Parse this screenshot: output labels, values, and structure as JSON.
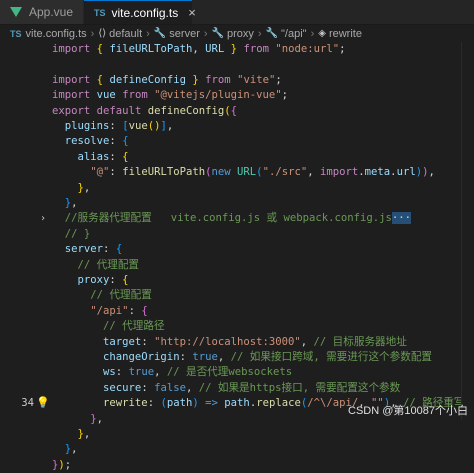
{
  "tabs": [
    {
      "label": "App.vue",
      "icon": "vue-icon",
      "active": false
    },
    {
      "label": "vite.config.ts",
      "icon": "ts-icon",
      "active": true
    }
  ],
  "breadcrumb": {
    "file_icon": "TS",
    "items": [
      "vite.config.ts",
      "default",
      "server",
      "proxy",
      "\"/api\"",
      "rewrite"
    ]
  },
  "editor": {
    "active_line": "34",
    "lines": [
      {
        "num": "",
        "tokens": [
          [
            "kw",
            "import"
          ],
          [
            "punc",
            " "
          ],
          [
            "br1",
            "{"
          ],
          [
            "punc",
            " "
          ],
          [
            "var",
            "fileURLToPath"
          ],
          [
            "punc",
            ", "
          ],
          [
            "var",
            "URL"
          ],
          [
            "punc",
            " "
          ],
          [
            "br1",
            "}"
          ],
          [
            "punc",
            " "
          ],
          [
            "kw",
            "from"
          ],
          [
            "punc",
            " "
          ],
          [
            "str",
            "\"node:url\""
          ],
          [
            "punc",
            ";"
          ]
        ]
      },
      {
        "num": "",
        "tokens": []
      },
      {
        "num": "",
        "tokens": [
          [
            "kw",
            "import"
          ],
          [
            "punc",
            " "
          ],
          [
            "br1",
            "{"
          ],
          [
            "punc",
            " "
          ],
          [
            "var",
            "defineConfig"
          ],
          [
            "punc",
            " "
          ],
          [
            "br1",
            "}"
          ],
          [
            "punc",
            " "
          ],
          [
            "kw",
            "from"
          ],
          [
            "punc",
            " "
          ],
          [
            "str",
            "\"vite\""
          ],
          [
            "punc",
            ";"
          ]
        ]
      },
      {
        "num": "",
        "tokens": [
          [
            "kw",
            "import"
          ],
          [
            "punc",
            " "
          ],
          [
            "var",
            "vue"
          ],
          [
            "punc",
            " "
          ],
          [
            "kw",
            "from"
          ],
          [
            "punc",
            " "
          ],
          [
            "str",
            "\"@vitejs/plugin-vue\""
          ],
          [
            "punc",
            ";"
          ]
        ]
      },
      {
        "num": "",
        "tokens": [
          [
            "kw",
            "export"
          ],
          [
            "punc",
            " "
          ],
          [
            "kw",
            "default"
          ],
          [
            "punc",
            " "
          ],
          [
            "fn",
            "defineConfig"
          ],
          [
            "br1",
            "("
          ],
          [
            "br2",
            "{"
          ]
        ]
      },
      {
        "num": "",
        "tokens": [
          [
            "punc",
            "  "
          ],
          [
            "prop",
            "plugins"
          ],
          [
            "punc",
            ": "
          ],
          [
            "br3",
            "["
          ],
          [
            "fn",
            "vue"
          ],
          [
            "br1",
            "()"
          ],
          [
            "br3",
            "]"
          ],
          [
            "punc",
            ","
          ]
        ]
      },
      {
        "num": "",
        "tokens": [
          [
            "punc",
            "  "
          ],
          [
            "prop",
            "resolve"
          ],
          [
            "punc",
            ": "
          ],
          [
            "br3",
            "{"
          ]
        ]
      },
      {
        "num": "",
        "tokens": [
          [
            "punc",
            "    "
          ],
          [
            "prop",
            "alias"
          ],
          [
            "punc",
            ": "
          ],
          [
            "br1",
            "{"
          ]
        ]
      },
      {
        "num": "",
        "tokens": [
          [
            "punc",
            "      "
          ],
          [
            "str",
            "\"@\""
          ],
          [
            "punc",
            ": "
          ],
          [
            "fn",
            "fileURLToPath"
          ],
          [
            "br2",
            "("
          ],
          [
            "kw2",
            "new"
          ],
          [
            "punc",
            " "
          ],
          [
            "cls",
            "URL"
          ],
          [
            "br3",
            "("
          ],
          [
            "str",
            "\"./src\""
          ],
          [
            "punc",
            ", "
          ],
          [
            "kw",
            "import"
          ],
          [
            "punc",
            "."
          ],
          [
            "prop",
            "meta"
          ],
          [
            "punc",
            "."
          ],
          [
            "prop",
            "url"
          ],
          [
            "br3",
            ")"
          ],
          [
            "br2",
            ")"
          ],
          [
            "punc",
            ","
          ]
        ]
      },
      {
        "num": "",
        "tokens": [
          [
            "punc",
            "    "
          ],
          [
            "br1",
            "}"
          ],
          [
            "punc",
            ","
          ]
        ]
      },
      {
        "num": "",
        "tokens": [
          [
            "punc",
            "  "
          ],
          [
            "br3",
            "}"
          ],
          [
            "punc",
            ","
          ]
        ]
      },
      {
        "num": "",
        "tokens": [
          [
            "punc",
            "  "
          ],
          [
            "cm",
            "//服务器代理配置   vite.config.js 或 webpack.config.js"
          ],
          [
            "punc",
            "···"
          ]
        ],
        "folded": true
      },
      {
        "num": "",
        "tokens": [
          [
            "punc",
            "  "
          ],
          [
            "cm",
            "// }"
          ]
        ]
      },
      {
        "num": "",
        "tokens": [
          [
            "punc",
            "  "
          ],
          [
            "prop",
            "server"
          ],
          [
            "punc",
            ": "
          ],
          [
            "br3",
            "{"
          ]
        ]
      },
      {
        "num": "",
        "tokens": [
          [
            "punc",
            "    "
          ],
          [
            "cm",
            "// 代理配置"
          ]
        ]
      },
      {
        "num": "",
        "tokens": [
          [
            "punc",
            "    "
          ],
          [
            "prop",
            "proxy"
          ],
          [
            "punc",
            ": "
          ],
          [
            "br1",
            "{"
          ]
        ]
      },
      {
        "num": "",
        "tokens": [
          [
            "punc",
            "      "
          ],
          [
            "cm",
            "// 代理配置"
          ]
        ]
      },
      {
        "num": "",
        "tokens": [
          [
            "punc",
            "      "
          ],
          [
            "str",
            "\"/api\""
          ],
          [
            "punc",
            ": "
          ],
          [
            "br2",
            "{"
          ]
        ]
      },
      {
        "num": "",
        "tokens": [
          [
            "punc",
            "        "
          ],
          [
            "cm",
            "// 代理路径"
          ]
        ]
      },
      {
        "num": "",
        "tokens": [
          [
            "punc",
            "        "
          ],
          [
            "prop",
            "target"
          ],
          [
            "punc",
            ": "
          ],
          [
            "str",
            "\"http://localhost:3000\""
          ],
          [
            "punc",
            ", "
          ],
          [
            "cm",
            "// 目标服务器地址"
          ]
        ]
      },
      {
        "num": "",
        "tokens": [
          [
            "punc",
            "        "
          ],
          [
            "prop",
            "changeOrigin"
          ],
          [
            "punc",
            ": "
          ],
          [
            "kw2",
            "true"
          ],
          [
            "punc",
            ", "
          ],
          [
            "cm",
            "// 如果接口跨域, 需要进行这个参数配置"
          ]
        ]
      },
      {
        "num": "",
        "tokens": [
          [
            "punc",
            "        "
          ],
          [
            "prop",
            "ws"
          ],
          [
            "punc",
            ": "
          ],
          [
            "kw2",
            "true"
          ],
          [
            "punc",
            ", "
          ],
          [
            "cm",
            "// 是否代理websockets"
          ]
        ]
      },
      {
        "num": "",
        "tokens": [
          [
            "punc",
            "        "
          ],
          [
            "prop",
            "secure"
          ],
          [
            "punc",
            ": "
          ],
          [
            "kw2",
            "false"
          ],
          [
            "punc",
            ", "
          ],
          [
            "cm",
            "// 如果是https接口, 需要配置这个参数"
          ]
        ]
      },
      {
        "num": "34",
        "tokens": [
          [
            "punc",
            "        "
          ],
          [
            "fn",
            "rewrite"
          ],
          [
            "punc",
            ": "
          ],
          [
            "br3",
            "("
          ],
          [
            "var",
            "path"
          ],
          [
            "br3",
            ")"
          ],
          [
            "punc",
            " "
          ],
          [
            "kw2",
            "=>"
          ],
          [
            "punc",
            " "
          ],
          [
            "var",
            "path"
          ],
          [
            "punc",
            "."
          ],
          [
            "fn",
            "replace"
          ],
          [
            "br3",
            "("
          ],
          [
            "str",
            "/^\\/api/"
          ],
          [
            "punc",
            ", "
          ],
          [
            "str",
            "\"\""
          ],
          [
            "br3",
            ")"
          ],
          [
            "punc",
            ", "
          ],
          [
            "cm",
            "// 路径重写"
          ]
        ]
      },
      {
        "num": "",
        "tokens": [
          [
            "punc",
            "      "
          ],
          [
            "br2",
            "}"
          ],
          [
            "punc",
            ","
          ]
        ]
      },
      {
        "num": "",
        "tokens": [
          [
            "punc",
            "    "
          ],
          [
            "br1",
            "}"
          ],
          [
            "punc",
            ","
          ]
        ]
      },
      {
        "num": "",
        "tokens": [
          [
            "punc",
            "  "
          ],
          [
            "br3",
            "}"
          ],
          [
            "punc",
            ","
          ]
        ]
      },
      {
        "num": "",
        "tokens": [
          [
            "br2",
            "}"
          ],
          [
            "br1",
            ")"
          ],
          [
            "punc",
            ";"
          ]
        ]
      }
    ]
  },
  "watermark": "CSDN @第10087个小白"
}
